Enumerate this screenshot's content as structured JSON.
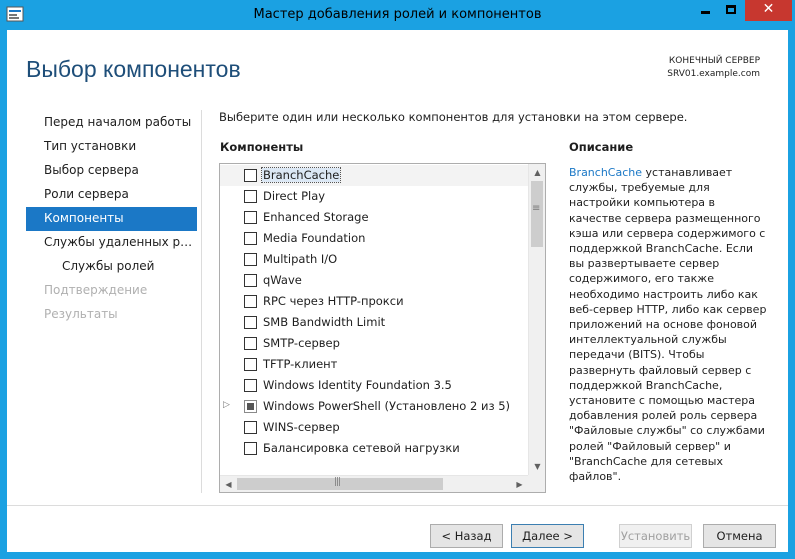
{
  "window": {
    "title": "Мастер добавления ролей и компонентов",
    "close_glyph": "✕",
    "icons": [
      "app-icon",
      "minimize-icon",
      "maximize-icon",
      "close-icon"
    ]
  },
  "header": {
    "page_title": "Выбор компонентов",
    "server_label": "КОНЕЧНЫЙ СЕРВЕР",
    "server_name": "SRV01.example.com"
  },
  "nav": {
    "items": [
      {
        "label": "Перед началом работы",
        "state": "normal",
        "sub": false
      },
      {
        "label": "Тип установки",
        "state": "normal",
        "sub": false
      },
      {
        "label": "Выбор сервера",
        "state": "normal",
        "sub": false
      },
      {
        "label": "Роли сервера",
        "state": "normal",
        "sub": false
      },
      {
        "label": "Компоненты",
        "state": "active",
        "sub": false
      },
      {
        "label": "Службы удаленных рабо...",
        "state": "normal",
        "sub": false
      },
      {
        "label": "Службы ролей",
        "state": "normal",
        "sub": true
      },
      {
        "label": "Подтверждение",
        "state": "disabled",
        "sub": false
      },
      {
        "label": "Результаты",
        "state": "disabled",
        "sub": false
      }
    ]
  },
  "main": {
    "instructions": "Выберите один или несколько компонентов для установки на этом сервере.",
    "components_header": "Компоненты",
    "description_header": "Описание",
    "components": [
      {
        "label": "BranchCache",
        "checked": false,
        "selected": true
      },
      {
        "label": "Direct Play",
        "checked": false
      },
      {
        "label": "Enhanced Storage",
        "checked": false
      },
      {
        "label": "Media Foundation",
        "checked": false
      },
      {
        "label": "Multipath I/O",
        "checked": false
      },
      {
        "label": "qWave",
        "checked": false
      },
      {
        "label": "RPC через HTTP-прокси",
        "checked": false
      },
      {
        "label": "SMB Bandwidth Limit",
        "checked": false
      },
      {
        "label": "SMTP-сервер",
        "checked": false
      },
      {
        "label": "TFTP-клиент",
        "checked": false
      },
      {
        "label": "Windows Identity Foundation 3.5",
        "checked": false
      },
      {
        "label": "Windows PowerShell (Установлено 2 из 5)",
        "checked": "partial",
        "expandable": true
      },
      {
        "label": "WINS-сервер",
        "checked": false
      },
      {
        "label": "Балансировка сетевой нагрузки",
        "checked": false
      }
    ],
    "description": {
      "link": "BranchCache",
      "text": " устанавливает службы, требуемые для настройки компьютера в качестве сервера размещенного кэша или сервера содержимого с поддержкой BranchCache. Если вы развертываете сервер содержимого, его также необходимо настроить либо как веб-сервер HTTP, либо как сервер приложений на основе фоновой интеллектуальной службы передачи (BITS). Чтобы развернуть файловый сервер с поддержкой BranchCache, установите с помощью мастера добавления ролей роль сервера \"Файловые службы\" со службами ролей \"Файловый сервер\" и \"BranchCache для сетевых файлов\"."
    }
  },
  "footer": {
    "back": "< Назад",
    "next": "Далее >",
    "install": "Установить",
    "cancel": "Отмена"
  },
  "colors": {
    "accent": "#1ba1e2",
    "nav_active": "#1b78c6",
    "title_blue": "#1e4e79",
    "close": "#c7372f"
  }
}
